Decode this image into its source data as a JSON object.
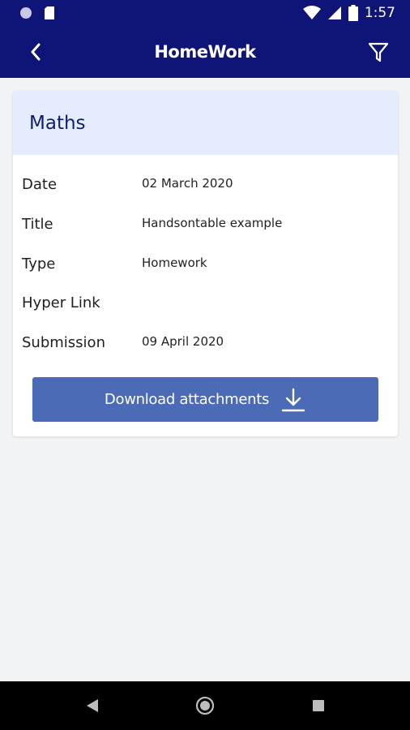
{
  "status_bar": {
    "time": "1:57",
    "icons": [
      "circle-icon",
      "sim-card-icon",
      "wifi-icon",
      "signal-icon",
      "battery-icon"
    ]
  },
  "app_bar": {
    "title": "HomeWork",
    "back_icon": "chevron-left-icon",
    "filter_icon": "filter-icon"
  },
  "homework": {
    "subject": "Maths",
    "fields": [
      {
        "label": "Date",
        "value": "02 March 2020"
      },
      {
        "label": "Title",
        "value": "Handsontable example"
      },
      {
        "label": "Type",
        "value": "Homework"
      },
      {
        "label": "Hyper Link",
        "value": ""
      },
      {
        "label": "Submission",
        "value": "09 April 2020"
      }
    ],
    "download_label": "Download attachments",
    "download_icon": "download-icon"
  },
  "colors": {
    "app_bar": "#0f1576",
    "card_header": "#e4edfd",
    "button": "#4b6bb7",
    "background": "#f2f3f5"
  },
  "nav_bar": {
    "icons": [
      "back-triangle-icon",
      "home-circle-icon",
      "recents-square-icon"
    ]
  }
}
